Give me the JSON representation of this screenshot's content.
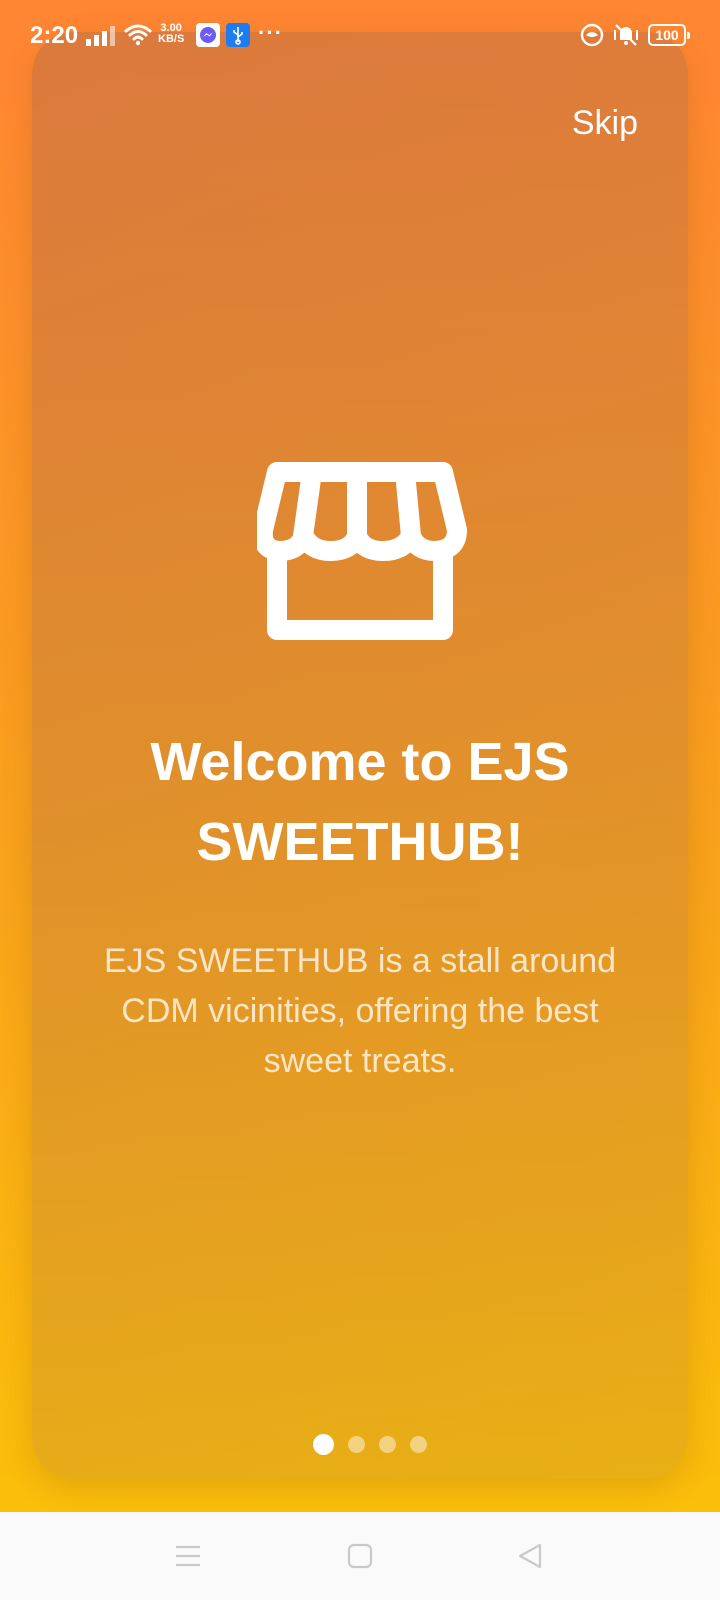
{
  "status_bar": {
    "time": "2:20",
    "speed_value": "3.00",
    "speed_unit": "KB/S",
    "overflow": "···",
    "battery": "100"
  },
  "onboarding": {
    "skip_label": "Skip",
    "icon": "store-icon",
    "title": "Welcome to EJS SWEETHUB!",
    "description": "EJS SWEETHUB is a stall around CDM vicinities, offering the best sweet treats.",
    "page_count": 4,
    "current_page": 1
  },
  "colors": {
    "gradient_top": "#ff8533",
    "gradient_bottom": "#fbbf0a",
    "text": "#ffffff"
  },
  "nav_bar": {
    "icons": [
      "menu-icon",
      "home-icon",
      "back-icon"
    ]
  }
}
